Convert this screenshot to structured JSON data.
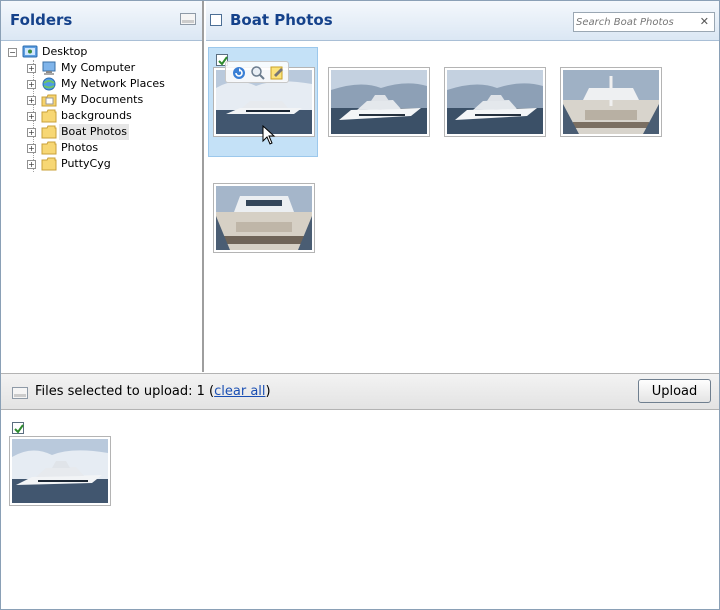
{
  "folders_panel": {
    "title": "Folders",
    "tree": [
      {
        "label": "Desktop",
        "icon": "desktop-icon",
        "level": 0,
        "expander": "−"
      },
      {
        "label": "My Computer",
        "icon": "computer-icon",
        "level": 1,
        "expander": "+"
      },
      {
        "label": "My Network Places",
        "icon": "network-icon",
        "level": 1,
        "expander": "+"
      },
      {
        "label": "My Documents",
        "icon": "documents-folder-icon",
        "level": 1,
        "expander": "+"
      },
      {
        "label": "backgrounds",
        "icon": "folder-icon",
        "level": 1,
        "expander": "+"
      },
      {
        "label": "Boat Photos",
        "icon": "folder-icon",
        "level": 1,
        "expander": "+",
        "selected": true
      },
      {
        "label": "Photos",
        "icon": "folder-icon",
        "level": 1,
        "expander": "+"
      },
      {
        "label": "PuttyCyg",
        "icon": "folder-icon",
        "level": 1,
        "expander": "+"
      }
    ]
  },
  "photos_panel": {
    "title": "Boat Photos",
    "search_placeholder": "Search Boat Photos",
    "clear_search": "✕",
    "photos": [
      {
        "name": "yacht-side-1",
        "selected": true
      },
      {
        "name": "yacht-side-2",
        "selected": false
      },
      {
        "name": "yacht-side-3",
        "selected": false
      },
      {
        "name": "yacht-deck-1",
        "selected": false
      },
      {
        "name": "yacht-deck-2",
        "selected": false
      }
    ]
  },
  "upload_bar": {
    "prefix": "Files selected to upload: 1 (",
    "clear_all": "clear all",
    "suffix": ")",
    "upload_button": "Upload"
  },
  "colors": {
    "header_title": "#15428b",
    "selection": "#c4e1f7",
    "link": "#1a4fb3"
  }
}
